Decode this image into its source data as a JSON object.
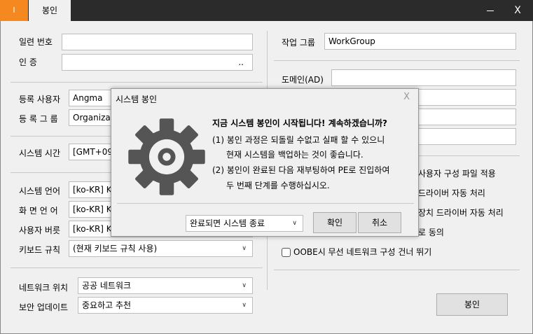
{
  "titlebar": {
    "app_icon_text": "I",
    "tab_label": "봉인",
    "close_glyph": "X"
  },
  "form": {
    "serial_label": "일련 번호",
    "serial_value": "",
    "auth_label": "인   증",
    "auth_button": "..",
    "reg_user_label": "등록 사용자",
    "reg_user_value": "Angma",
    "reg_group_label": "등 록  그 룹",
    "reg_group_value": "Organizati",
    "system_time_label": "시스템 시간",
    "system_time_value": "[GMT+09:",
    "system_lang_label": "시스템 언어",
    "system_lang_value": "[ko-KR] Ko",
    "display_lang_label": "화 면  언 어",
    "display_lang_value": "[ko-KR] Ko",
    "user_locale_label": "사용자 버릇",
    "user_locale_value": "[ko-KR] Ko",
    "keyboard_label": "키보드 규칙",
    "keyboard_value": "(현재 키보드 규칙 사용)",
    "network_location_label": "네트워크 위치",
    "network_location_value": "공공 네트워크",
    "security_update_label": "보안 업데이트",
    "security_update_value": "중요하고 추천",
    "workgroup_label": "작업 그룹",
    "workgroup_value": "WorkGroup",
    "domain_label": "도메인(AD)",
    "domain_value": ""
  },
  "options": {
    "opt1": "사용자 구성 파일 적용",
    "opt2": "드라이버 자동 처리",
    "opt3": "장치 드라이버 자동 처리",
    "opt4": "로 동의",
    "opt5": "OOBE시 무선 네트워크 구성 건너 뛰기"
  },
  "seal_button": "봉인",
  "dialog": {
    "title": "시스템 봉인",
    "close": "X",
    "heading": "지금 시스템 봉인이 시작됩니다! 계속하겠습니까?",
    "line1": "(1) 봉인 과정은 되돌릴 수없고 실패 할 수 있으니",
    "line2": "현재 시스템을 백업하는 것이 좋습니다.",
    "line3": "(2) 봉인이 완료된 다음 재부팅하여 PE로 진입하여",
    "line4": "두 번째 단계를 수행하십시오.",
    "after_action": "완료되면 시스템 종료",
    "confirm": "확인",
    "cancel": "취소"
  },
  "icons": {
    "gear": "gear-icon",
    "chevron": "chevron-down-icon"
  },
  "colors": {
    "accent": "#f5891f",
    "titlebar": "#2b2b2b",
    "gear": "#555555"
  }
}
